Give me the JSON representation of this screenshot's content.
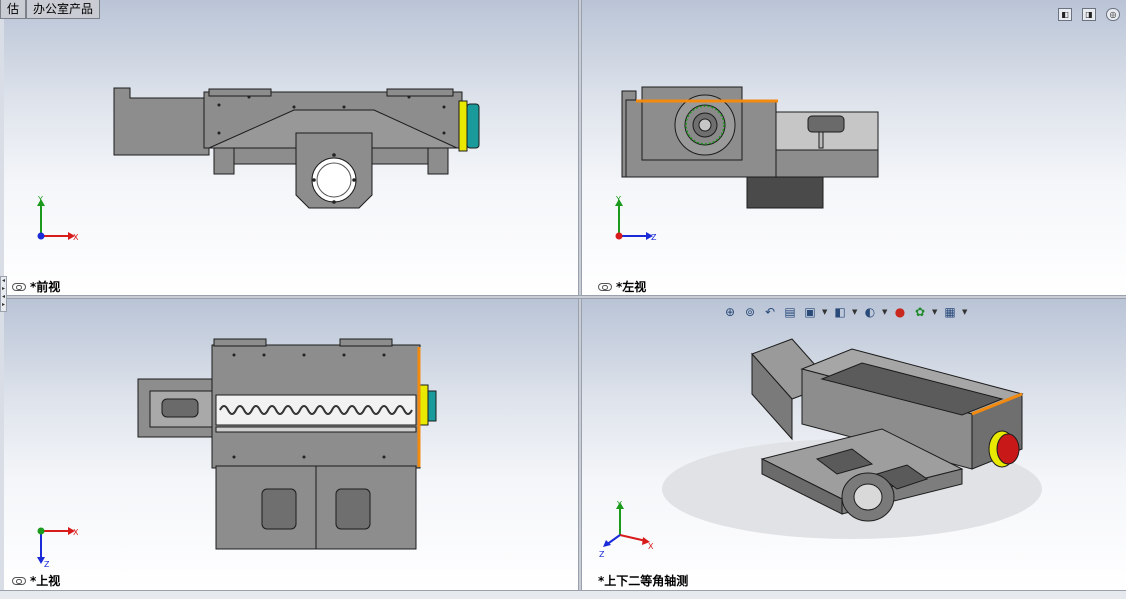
{
  "tabs": [
    "估",
    "办公室产品"
  ],
  "window_controls": [
    "◧",
    "◨",
    "◎"
  ],
  "views": {
    "front": {
      "label": "*前视"
    },
    "left": {
      "label": "*左视"
    },
    "top": {
      "label": "*上视"
    },
    "iso": {
      "label": "*上下二等角轴测"
    }
  },
  "axis_labels": {
    "x": "X",
    "y": "Y",
    "z": "Z"
  },
  "view_toolbar": {
    "icons": [
      "zoom-to-fit-icon",
      "zoom-to-area-icon",
      "previous-view-icon",
      "section-view-icon",
      "view-orientation-icon",
      "display-style-icon",
      "hide-show-items-icon",
      "edit-appearance-icon",
      "apply-scene-icon",
      "view-settings-icon"
    ]
  },
  "colors": {
    "part": "#8d8d8d",
    "part_dark": "#5a5a5a",
    "edge": "#1c1c1c",
    "highlight": "#f28a10",
    "motor_teal": "#1a9a9a",
    "motor_yellow": "#e8e800",
    "motor_red": "#c81818",
    "axis_x": "#d81b1b",
    "axis_y": "#1b9a1b",
    "axis_z": "#1b2bd8"
  }
}
